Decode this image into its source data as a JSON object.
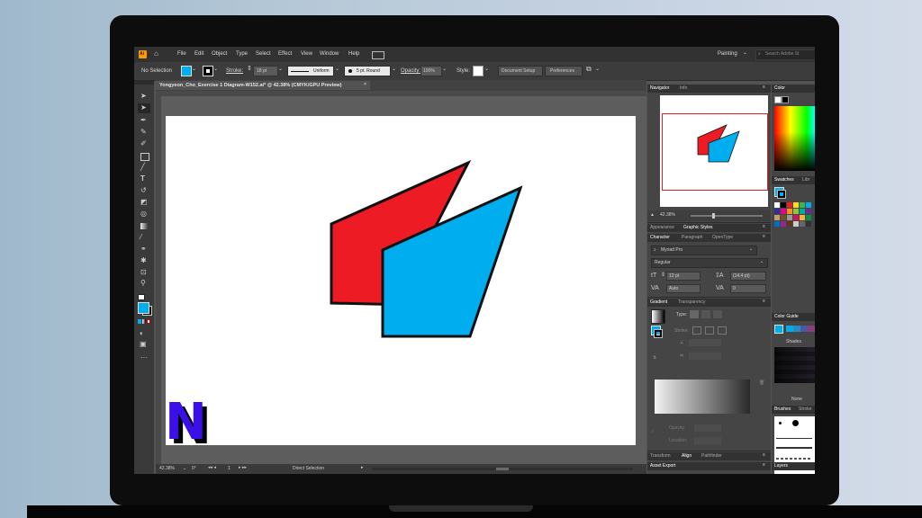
{
  "menu": {
    "app_icon": "Ai",
    "items": [
      "File",
      "Edit",
      "Object",
      "Type",
      "Select",
      "Effect",
      "View",
      "Window",
      "Help"
    ],
    "workspace": "Painting",
    "search_placeholder": "Search Adobe St"
  },
  "control_bar": {
    "selection": "No Selection",
    "stroke_label": "Stroke:",
    "stroke_value": "18 pt",
    "profile": "Uniform",
    "brush": "5 pt. Round",
    "opacity_label": "Opacity:",
    "opacity_value": "100%",
    "style_label": "Style:",
    "document_setup": "Document Setup",
    "preferences": "Preferences"
  },
  "document": {
    "tab_title": "Yongyeon_Cho_Exercise 1 Diagram-W152.ai* @ 42.38% (CMYK/GPU Preview)"
  },
  "status_bar": {
    "zoom": "42.38%",
    "rotation": "0°",
    "artboard": "1",
    "tool": "Direct Selection"
  },
  "navigator": {
    "tabs": [
      "Navigator",
      "Info"
    ],
    "zoom": "42.38%"
  },
  "appearance_tabs": [
    "Appearance",
    "Graphic Styles"
  ],
  "character": {
    "tabs": [
      "Character",
      "Paragraph",
      "OpenType"
    ],
    "font_family": "Myriad Pro",
    "font_style": "Regular",
    "font_size": "12 pt",
    "leading": "(14.4 pt)",
    "kerning": "Auto",
    "tracking": "0"
  },
  "gradient": {
    "tabs": [
      "Gradient",
      "Transparency"
    ],
    "type_label": "Type:",
    "stroke_label": "Stroke:",
    "opacity_label": "Opacity:",
    "location_label": "Location:"
  },
  "bottom_tabs": [
    "Transform",
    "Align",
    "Pathfinder"
  ],
  "asset_export": "Asset Export",
  "right_panels": {
    "color": "Color",
    "swatches_tabs": [
      "Swatches",
      "Libr"
    ],
    "color_guide": "Color Guide",
    "shades": "Shades",
    "none": "None",
    "brushes_tabs": [
      "Brushes",
      "Stroke"
    ],
    "layers": "Layers"
  },
  "colors": {
    "red_shape": "#ed1c24",
    "blue_shape": "#00aeef",
    "logo": "#3b10e8"
  },
  "logo_letter": "N"
}
